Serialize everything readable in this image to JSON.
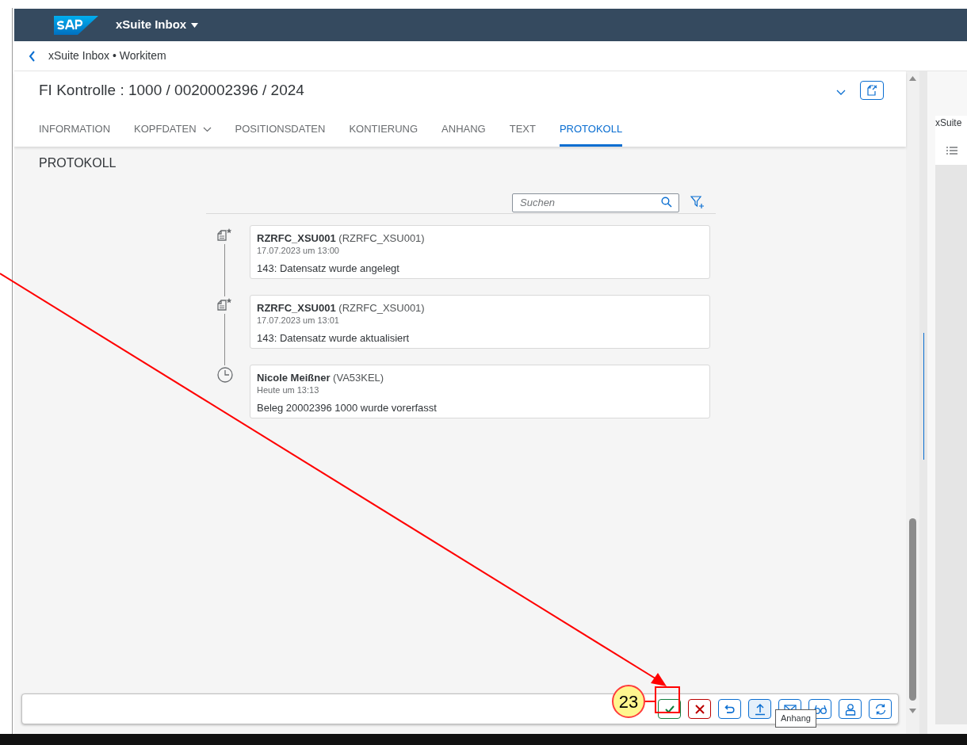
{
  "shell": {
    "app_title": "xSuite Inbox"
  },
  "breadcrumb": "xSuite Inbox • Workitem",
  "object_header": {
    "title": "FI Kontrolle : 1000 / 0020002396 / 2024"
  },
  "tabs": [
    {
      "label": "INFORMATION",
      "selected": false,
      "has_menu": false
    },
    {
      "label": "KOPFDATEN",
      "selected": false,
      "has_menu": true
    },
    {
      "label": "POSITIONSDATEN",
      "selected": false,
      "has_menu": false
    },
    {
      "label": "KONTIERUNG",
      "selected": false,
      "has_menu": false
    },
    {
      "label": "ANHANG",
      "selected": false,
      "has_menu": false
    },
    {
      "label": "TEXT",
      "selected": false,
      "has_menu": false
    },
    {
      "label": "PROTOKOLL",
      "selected": true,
      "has_menu": false
    }
  ],
  "section_title": "PROTOKOLL",
  "search": {
    "placeholder": "Suchen"
  },
  "timeline": [
    {
      "kind": "document",
      "author": "RZRFC_XSU001",
      "user_id": "(RZRFC_XSU001)",
      "date": "17.07.2023 um 13:00",
      "text": "143: Datensatz wurde angelegt"
    },
    {
      "kind": "document",
      "author": "RZRFC_XSU001",
      "user_id": "(RZRFC_XSU001)",
      "date": "17.07.2023 um 13:01",
      "text": "143: Datensatz wurde aktualisiert"
    },
    {
      "kind": "clock",
      "author": "Nicole Meißner",
      "user_id": "(VA53KEL)",
      "date": "Heute um 13:13",
      "text": "Beleg 20002396 1000 wurde vorerfasst"
    }
  ],
  "footer_buttons": [
    {
      "kind": "approve",
      "hovered": false
    },
    {
      "kind": "reject",
      "hovered": false
    },
    {
      "kind": "return",
      "hovered": false
    },
    {
      "kind": "upload",
      "hovered": true
    },
    {
      "kind": "mail",
      "hovered": false
    },
    {
      "kind": "view",
      "hovered": false
    },
    {
      "kind": "user",
      "hovered": false
    },
    {
      "kind": "refresh",
      "hovered": false
    }
  ],
  "tooltip": "Anhang",
  "side_panel": {
    "title": "xSuite"
  },
  "callout": {
    "number": "23"
  }
}
